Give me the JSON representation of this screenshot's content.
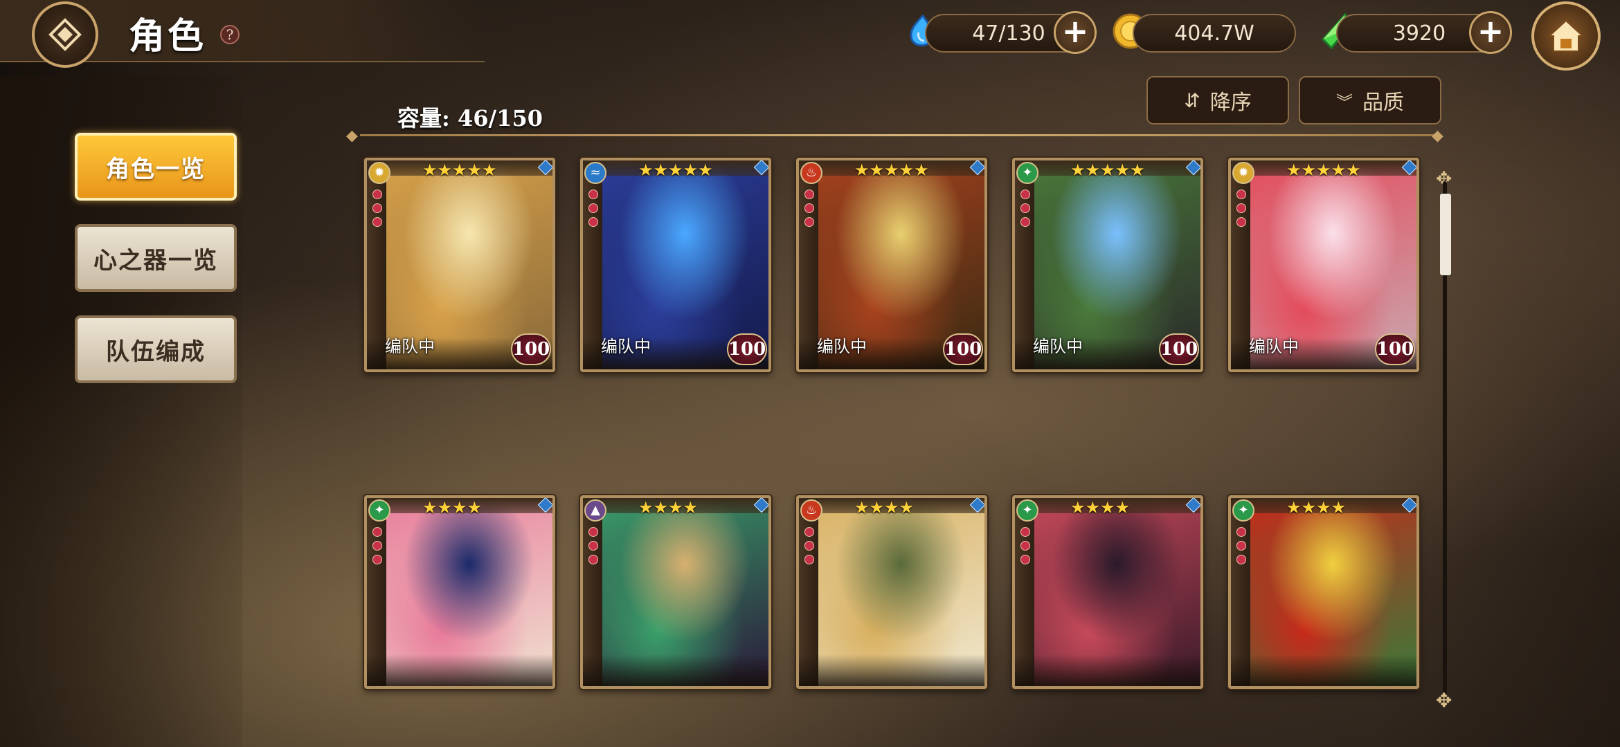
{
  "header": {
    "title": "角色",
    "help_symbol": "?"
  },
  "resources": {
    "stamina": {
      "icon": "water-drop-icon",
      "value": "47/130"
    },
    "gold": {
      "icon": "gold-coin-icon",
      "value": "404.7W"
    },
    "gems": {
      "icon": "green-crystal-icon",
      "value": "3920"
    },
    "plus_symbol": "+"
  },
  "controls": {
    "sort_label": "降序",
    "filter_label": "品质"
  },
  "capacity_label": "容量: 46/150",
  "side_menu": [
    {
      "label": "角色一览",
      "active": true
    },
    {
      "label": "心之器一览",
      "active": false
    },
    {
      "label": "队伍编成",
      "active": false
    }
  ],
  "cards": [
    {
      "element": "light",
      "stars": "★★★★★",
      "team_tag": "编队中",
      "level": "100",
      "colors": [
        "#f6e7b0",
        "#d9a24a",
        "#8a6a3a"
      ]
    },
    {
      "element": "water",
      "stars": "★★★★★",
      "team_tag": "编队中",
      "level": "100",
      "colors": [
        "#4aa8ff",
        "#2c3e9a",
        "#141a4a"
      ]
    },
    {
      "element": "fire",
      "stars": "★★★★★",
      "team_tag": "编队中",
      "level": "100",
      "colors": [
        "#e8d070",
        "#a8421e",
        "#3a2a12"
      ]
    },
    {
      "element": "wind",
      "stars": "★★★★★",
      "team_tag": "编队中",
      "level": "100",
      "colors": [
        "#7ac0ff",
        "#4a7a3a",
        "#2a2a2a"
      ]
    },
    {
      "element": "light",
      "stars": "★★★★★",
      "team_tag": "编队中",
      "level": "100",
      "colors": [
        "#fbe0ea",
        "#e44a5a",
        "#c9a8b0"
      ]
    },
    {
      "element": "wind",
      "stars": "★★★★",
      "team_tag": "",
      "level": "",
      "colors": [
        "#1a2a6a",
        "#e87a9a",
        "#f0e0d0"
      ]
    },
    {
      "element": "dark",
      "stars": "★★★★",
      "team_tag": "",
      "level": "",
      "colors": [
        "#d8b070",
        "#3aa06a",
        "#2a1a3a"
      ]
    },
    {
      "element": "fire",
      "stars": "★★★★",
      "team_tag": "",
      "level": "",
      "colors": [
        "#5a6a3a",
        "#d8b060",
        "#f0e8d0"
      ]
    },
    {
      "element": "wind",
      "stars": "★★★★",
      "team_tag": "",
      "level": "",
      "colors": [
        "#2a1a2a",
        "#c84a5a",
        "#3a1a2a"
      ]
    },
    {
      "element": "wind",
      "stars": "★★★★",
      "team_tag": "",
      "level": "",
      "colors": [
        "#f0d040",
        "#c8281a",
        "#3a7a3a"
      ]
    }
  ]
}
